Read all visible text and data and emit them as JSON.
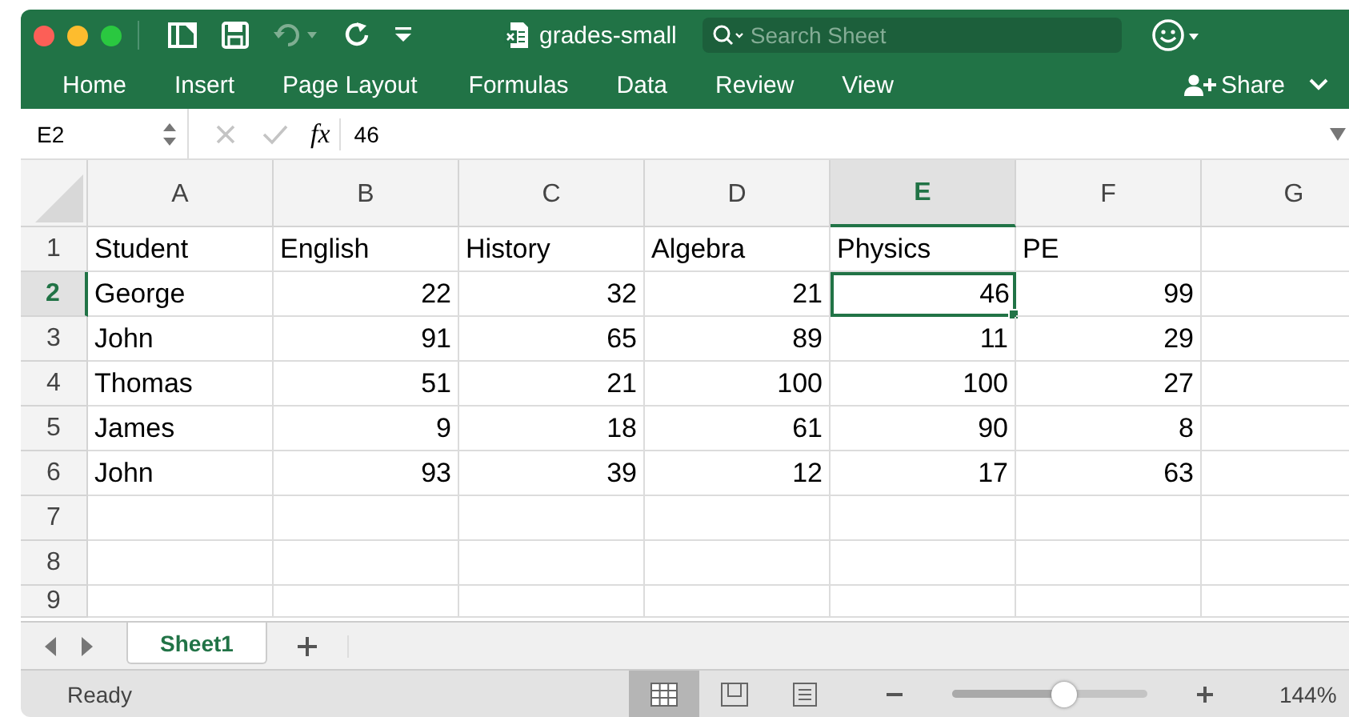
{
  "window": {
    "title": "grades-small"
  },
  "search": {
    "placeholder": "Search Sheet"
  },
  "ribbon_tabs": [
    {
      "label": "Home"
    },
    {
      "label": "Insert"
    },
    {
      "label": "Page Layout"
    },
    {
      "label": "Formulas"
    },
    {
      "label": "Data"
    },
    {
      "label": "Review"
    },
    {
      "label": "View"
    }
  ],
  "share_button": "Share",
  "formula_bar": {
    "name_box": "E2",
    "fx": "fx",
    "formula": "46"
  },
  "grid": {
    "columns": [
      {
        "label": "A",
        "kind": "text",
        "selected": false
      },
      {
        "label": "B",
        "kind": "number",
        "selected": false
      },
      {
        "label": "C",
        "kind": "number",
        "selected": false
      },
      {
        "label": "D",
        "kind": "number",
        "selected": false
      },
      {
        "label": "E",
        "kind": "number",
        "selected": true
      },
      {
        "label": "F",
        "kind": "number",
        "selected": false
      },
      {
        "label": "G",
        "kind": "number",
        "selected": false
      }
    ],
    "rows": [
      {
        "label": "1",
        "kind": "header",
        "selected": false,
        "cells": [
          "Student",
          "English",
          "History",
          "Algebra",
          "Physics",
          "PE"
        ]
      },
      {
        "label": "2",
        "kind": "data",
        "selected": true,
        "cells": [
          "George",
          "22",
          "32",
          "21",
          "46",
          "99"
        ]
      },
      {
        "label": "3",
        "kind": "data",
        "selected": false,
        "cells": [
          "John",
          "91",
          "65",
          "89",
          "11",
          "29"
        ]
      },
      {
        "label": "4",
        "kind": "data",
        "selected": false,
        "cells": [
          "Thomas",
          "51",
          "21",
          "100",
          "100",
          "27"
        ]
      },
      {
        "label": "5",
        "kind": "data",
        "selected": false,
        "cells": [
          "James",
          "9",
          "18",
          "61",
          "90",
          "8"
        ]
      },
      {
        "label": "6",
        "kind": "data",
        "selected": false,
        "cells": [
          "John",
          "93",
          "39",
          "12",
          "17",
          "63"
        ]
      },
      {
        "label": "7",
        "kind": "data",
        "selected": false,
        "cells": []
      },
      {
        "label": "8",
        "kind": "data",
        "selected": false,
        "cells": []
      },
      {
        "label": "9",
        "kind": "data",
        "selected": false,
        "cells": []
      }
    ]
  },
  "sheet_tabs": [
    {
      "label": "Sheet1",
      "selected": true
    }
  ],
  "status_bar": {
    "status": "Ready",
    "views": [
      {
        "kind": "normal",
        "selected": true
      },
      {
        "kind": "page-layout",
        "selected": false
      },
      {
        "kind": "page-break",
        "selected": false
      }
    ],
    "zoom": {
      "level": 0.57,
      "reading": "144%"
    }
  }
}
